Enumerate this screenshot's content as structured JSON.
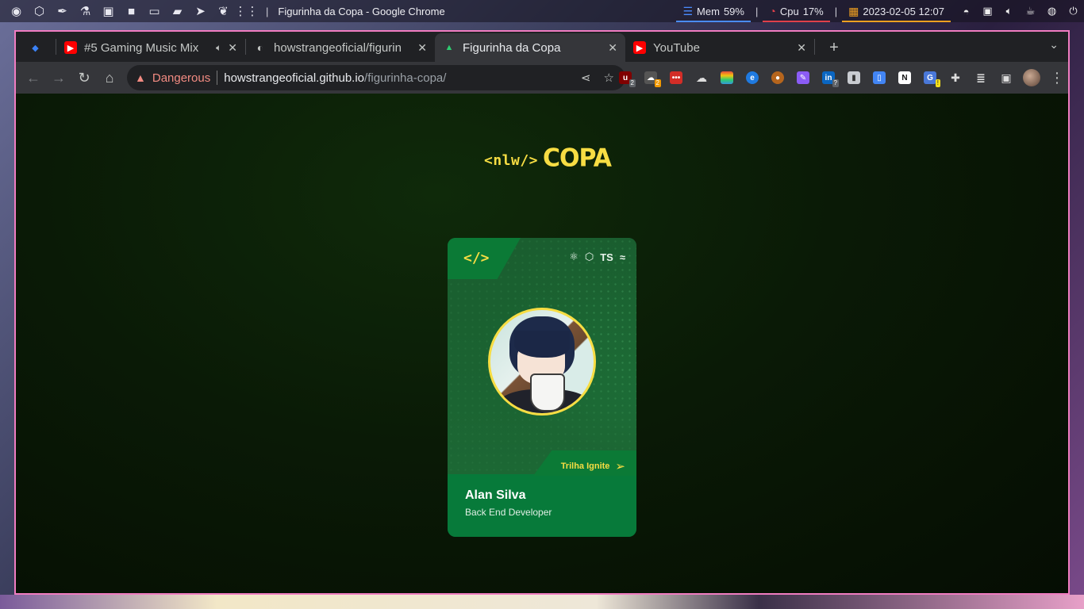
{
  "system_bar": {
    "window_title": "Figurinha da Copa - Google Chrome",
    "launcher_icons": [
      "globe-icon",
      "codepen-icon",
      "eyedropper-icon",
      "flask-icon",
      "image-icon",
      "video-icon",
      "laptop-icon",
      "folder-icon",
      "telegram-icon",
      "paw-icon",
      "grid-icon"
    ],
    "mem_label": "Mem",
    "mem_value": "59%",
    "cpu_label": "Cpu",
    "cpu_value": "17%",
    "datetime": "2023-02-05 12:07",
    "separator": "|",
    "colors": {
      "mem": "#4a8cff",
      "cpu": "#e0404a",
      "clock": "#f0a020"
    }
  },
  "browser": {
    "tabs": [
      {
        "label": "",
        "icon": "gem-icon"
      },
      {
        "label": "#5 Gaming Music Mix",
        "icon": "youtube-icon",
        "audio": "speaker-icon"
      },
      {
        "label": "howstrangeoficial/figurin",
        "icon": "github-icon"
      },
      {
        "label": "Figurinha da Copa",
        "icon": "nlw-icon",
        "active": true
      },
      {
        "label": "YouTube",
        "icon": "youtube-icon"
      }
    ],
    "close_glyph": "✕",
    "new_tab_glyph": "+",
    "omnibox": {
      "warning": "Dangerous",
      "url_host": "howstrangeoficial.github.io",
      "url_path": "/figurinha-copa/"
    },
    "extensions": [
      {
        "name": "ublock-icon",
        "color": "#800000",
        "text": "uO",
        "badge": "2"
      },
      {
        "name": "tampermonkey-icon",
        "color": "#444",
        "text": "☁",
        "badge": "2"
      },
      {
        "name": "lastpass-icon",
        "color": "#d32d27",
        "text": "•••"
      },
      {
        "name": "cloud-icon",
        "color": "#35363a",
        "text": "☁"
      },
      {
        "name": "stack-icon",
        "color": "#3c8d5a",
        "text": "≡"
      },
      {
        "name": "edge-icon",
        "color": "#1f7ae0",
        "text": "e"
      },
      {
        "name": "cookie-icon",
        "color": "#a0522d",
        "text": "●"
      },
      {
        "name": "pen-icon",
        "color": "#8b5cf6",
        "text": "✎"
      },
      {
        "name": "linkedin-icon",
        "color": "#0a66c2",
        "text": "in",
        "badge": "?"
      },
      {
        "name": "storage-icon",
        "color": "#9aa0a6",
        "text": "▮"
      },
      {
        "name": "copy-icon",
        "color": "#4285f4",
        "text": "▯"
      },
      {
        "name": "notion-icon",
        "color": "#2b2b2b",
        "text": "N"
      },
      {
        "name": "translate-icon",
        "color": "#4a78d8",
        "text": "G",
        "badge": "!"
      },
      {
        "name": "puzzle-icon",
        "color": "#35363a",
        "text": "✚"
      },
      {
        "name": "playlist-icon",
        "color": "#35363a",
        "text": "≣"
      },
      {
        "name": "sidepanel-icon",
        "color": "#35363a",
        "text": "▣"
      }
    ]
  },
  "page": {
    "logo_tag": "<nlw/>",
    "logo_word": "COPA",
    "card": {
      "code_glyph": "</>",
      "tech": [
        "react-icon",
        "node-icon",
        "TS",
        "tailwind-icon"
      ],
      "ts_label": "TS",
      "track": "Trilha Ignite",
      "name": "Alan Silva",
      "role": "Back End Developer"
    },
    "colors": {
      "accent": "#f7dd43",
      "card_green": "#077a3a"
    }
  }
}
